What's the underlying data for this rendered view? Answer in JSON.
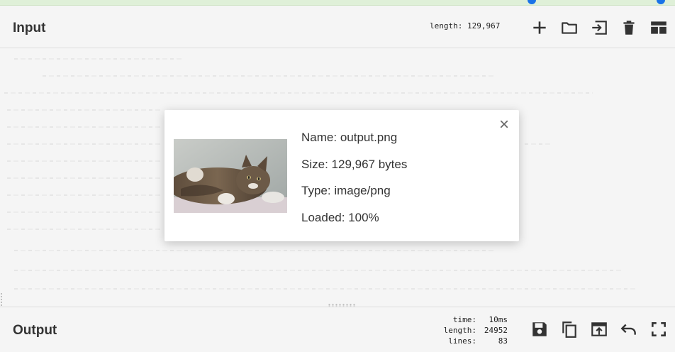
{
  "input_pane": {
    "title": "Input",
    "length_label": "length:",
    "length_value": "129,967",
    "toolbar": [
      "add-icon",
      "open-folder-icon",
      "import-icon",
      "trash-icon",
      "layout-icon"
    ]
  },
  "file_modal": {
    "name_label": "Name:",
    "name_value": "output.png",
    "size_label": "Size:",
    "size_value": "129,967 bytes",
    "type_label": "Type:",
    "type_value": "image/png",
    "loaded_label": "Loaded:",
    "loaded_value": "100%",
    "close_symbol": "×",
    "loaded_fraction": 1.0
  },
  "output_pane": {
    "title": "Output",
    "stats": [
      {
        "label": "time:",
        "value": "10ms"
      },
      {
        "label": "length:",
        "value": "24952"
      },
      {
        "label": "lines:",
        "value": "83"
      }
    ],
    "toolbar": [
      "save-icon",
      "copy-icon",
      "replace-input-icon",
      "undo-icon",
      "maximize-icon"
    ]
  },
  "colors": {
    "top_strip": "#dff0d8",
    "accent": "#1a73e8",
    "icon": "#333333"
  }
}
